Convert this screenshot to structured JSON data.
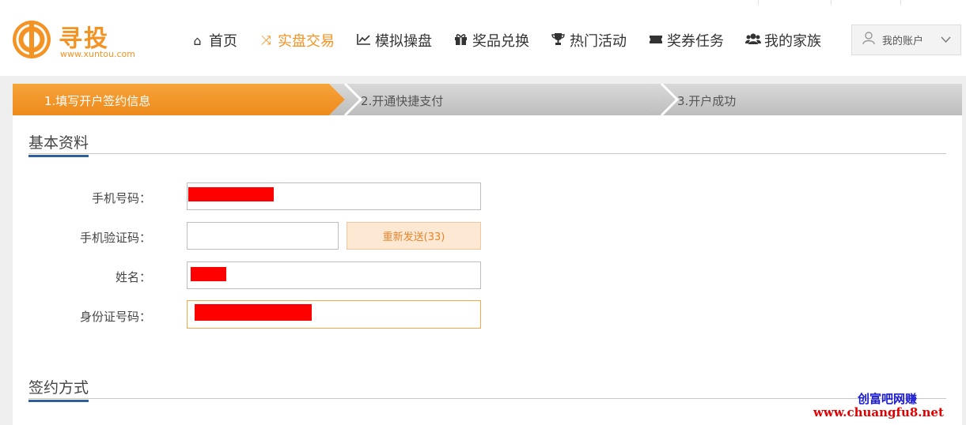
{
  "brand": {
    "name": "寻投",
    "url_text": "www.xuntou.com",
    "accent_color": "#f39323"
  },
  "nav": {
    "items": [
      {
        "label": "首页",
        "icon": "home-icon"
      },
      {
        "label": "实盘交易",
        "icon": "shuffle-icon",
        "active": true
      },
      {
        "label": "模拟操盘",
        "icon": "line-chart-icon"
      },
      {
        "label": "奖品兑换",
        "icon": "gift-icon"
      },
      {
        "label": "热门活动",
        "icon": "trophy-icon"
      },
      {
        "label": "奖券任务",
        "icon": "ticket-icon"
      },
      {
        "label": "我的家族",
        "icon": "users-icon"
      }
    ]
  },
  "account": {
    "label": "我的账户",
    "icon": "user-icon"
  },
  "steps": [
    {
      "label": "1.填写开户签约信息",
      "state": "active"
    },
    {
      "label": "2.开通快捷支付",
      "state": "inactive"
    },
    {
      "label": "3.开户成功",
      "state": "inactive"
    }
  ],
  "basic_info": {
    "title": "基本资料",
    "phone_label": "手机号码：",
    "code_label": "手机验证码：",
    "resend_label": "重新发送(33)",
    "name_label": "姓名：",
    "id_label": "身份证号码："
  },
  "sign_method": {
    "title": "签约方式"
  },
  "watermark": {
    "cn": "创富吧网赚",
    "url": "www.chuangfu8.net"
  }
}
